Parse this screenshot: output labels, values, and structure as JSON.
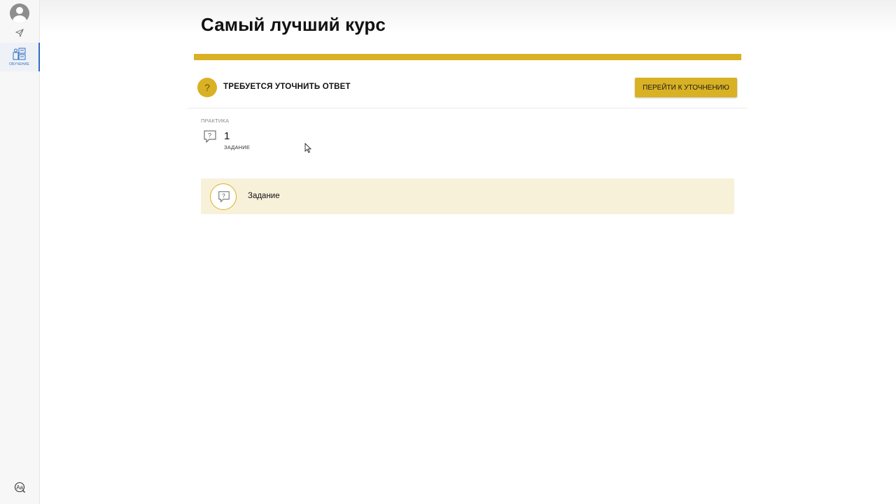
{
  "sidebar": {
    "nav_learning_label": "ОБУЧЕНИЕ",
    "active_color": "#2f6ec1"
  },
  "main": {
    "title": "Самый лучший курс",
    "progress_percent": 100,
    "accent_color": "#d9b124",
    "notice": {
      "icon_char": "?",
      "text": "ТРЕБУЕТСЯ УТОЧНИТЬ ОТВЕТ",
      "button_label": "ПЕРЕЙТИ К УТОЧНЕНИЮ"
    },
    "practice": {
      "caption": "ПРАКТИКА",
      "count": "1",
      "sublabel": "ЗАДАНИЕ"
    },
    "task": {
      "label": "Задание",
      "icon": "question-bubble-icon"
    }
  }
}
